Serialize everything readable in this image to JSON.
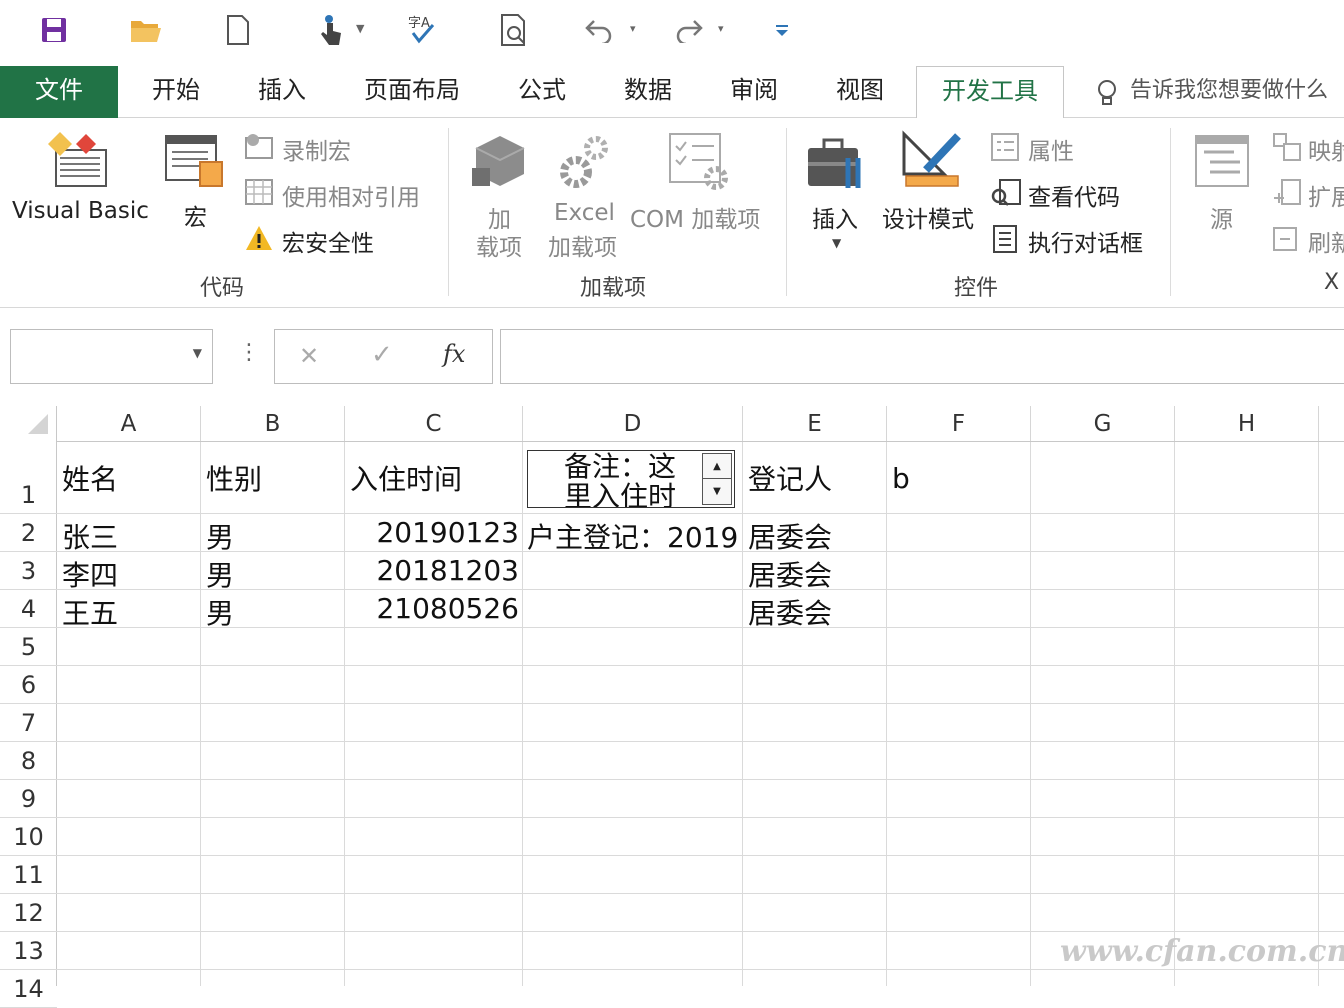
{
  "qat": {
    "icons": [
      "save-icon",
      "open-icon",
      "new-icon",
      "touch-mode-icon",
      "spelling-icon",
      "print-preview-icon",
      "undo-icon",
      "redo-icon",
      "customize-qat-icon"
    ]
  },
  "tabs": {
    "file": "文件",
    "home": "开始",
    "insert": "插入",
    "layout": "页面布局",
    "formulas": "公式",
    "data": "数据",
    "review": "审阅",
    "view": "视图",
    "developer": "开发工具",
    "tell_me": "告诉我您想要做什么"
  },
  "ribbon": {
    "code": {
      "visual_basic": "Visual Basic",
      "macros": "宏",
      "record_macro": "录制宏",
      "relative_ref": "使用相对引用",
      "macro_security": "宏安全性",
      "group_label": "代码"
    },
    "addins": {
      "addins_line1": "加",
      "addins_line2": "载项",
      "excel_line1": "Excel",
      "excel_line2": "加载项",
      "com": "COM 加载项",
      "group_label": "加载项"
    },
    "controls": {
      "insert": "插入",
      "design_mode": "设计模式",
      "properties": "属性",
      "view_code": "查看代码",
      "run_dialog": "执行对话框",
      "group_label": "控件"
    },
    "xml": {
      "source": "源",
      "map": "映射",
      "expand": "扩展",
      "refresh": "刷新",
      "group_label": "X"
    }
  },
  "formula_bar": {
    "name_box": "",
    "fx": "fx",
    "formula": ""
  },
  "sheet": {
    "columns": [
      "A",
      "B",
      "C",
      "D",
      "E",
      "F",
      "G",
      "H"
    ],
    "rows": [
      "1",
      "2",
      "3",
      "4",
      "5",
      "6",
      "7",
      "8",
      "9",
      "10",
      "11",
      "12",
      "13",
      "14"
    ],
    "cells": {
      "A1": "姓名",
      "B1": "性别",
      "C1": "入住时间",
      "E1": "登记人",
      "F1": "b",
      "A2": "张三",
      "B2": "男",
      "C2": "20190123",
      "D2": "户主登记：2019",
      "E2": "居委会",
      "A3": "李四",
      "B3": "男",
      "C3": "20181203",
      "E3": "居委会",
      "A4": "王五",
      "B4": "男",
      "C4": "21080526",
      "E4": "居委会"
    },
    "textbox_line1": "备注：这",
    "textbox_line2": "里入住时"
  },
  "watermark": "www.cfan.com.cn"
}
